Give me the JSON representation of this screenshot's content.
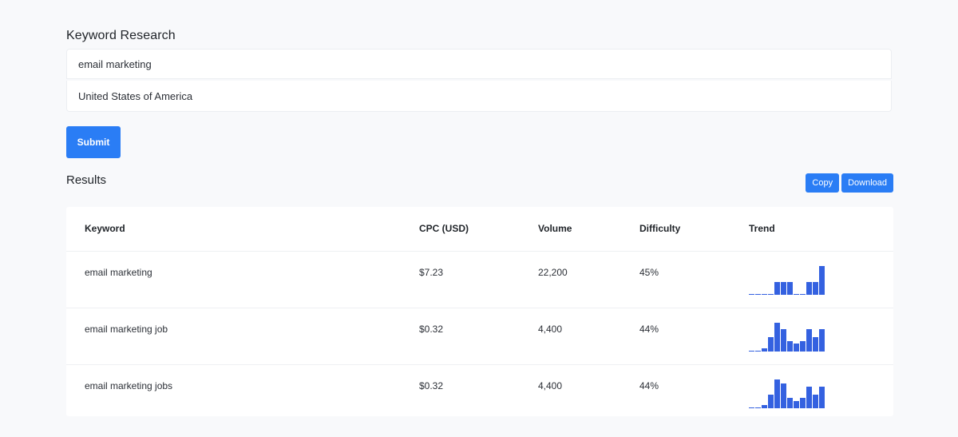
{
  "page": {
    "title": "Keyword Research"
  },
  "form": {
    "keyword_value": "email marketing",
    "location_value": "United States of America",
    "submit_label": "Submit"
  },
  "results": {
    "title": "Results",
    "copy_label": "Copy",
    "download_label": "Download",
    "bar_color": "#3461e0",
    "columns": [
      "Keyword",
      "CPC (USD)",
      "Volume",
      "Difficulty",
      "Trend"
    ],
    "rows": [
      {
        "keyword": "email marketing",
        "cpc": "$7.23",
        "volume": "22,200",
        "difficulty": "45%",
        "trend": [
          0,
          0,
          0,
          0,
          0.44,
          0.44,
          0.44,
          0,
          0,
          0.44,
          0.44,
          1
        ]
      },
      {
        "keyword": "email marketing job",
        "cpc": "$0.32",
        "volume": "4,400",
        "difficulty": "44%",
        "trend": [
          0,
          0,
          0.1,
          0.5,
          1,
          0.78,
          0.36,
          0.27,
          0.36,
          0.78,
          0.5,
          0.78
        ]
      },
      {
        "keyword": "email marketing jobs",
        "cpc": "$0.32",
        "volume": "4,400",
        "difficulty": "44%",
        "trend": [
          0,
          0,
          0.1,
          0.47,
          1,
          0.86,
          0.36,
          0.26,
          0.36,
          0.76,
          0.47,
          0.76
        ]
      }
    ]
  }
}
